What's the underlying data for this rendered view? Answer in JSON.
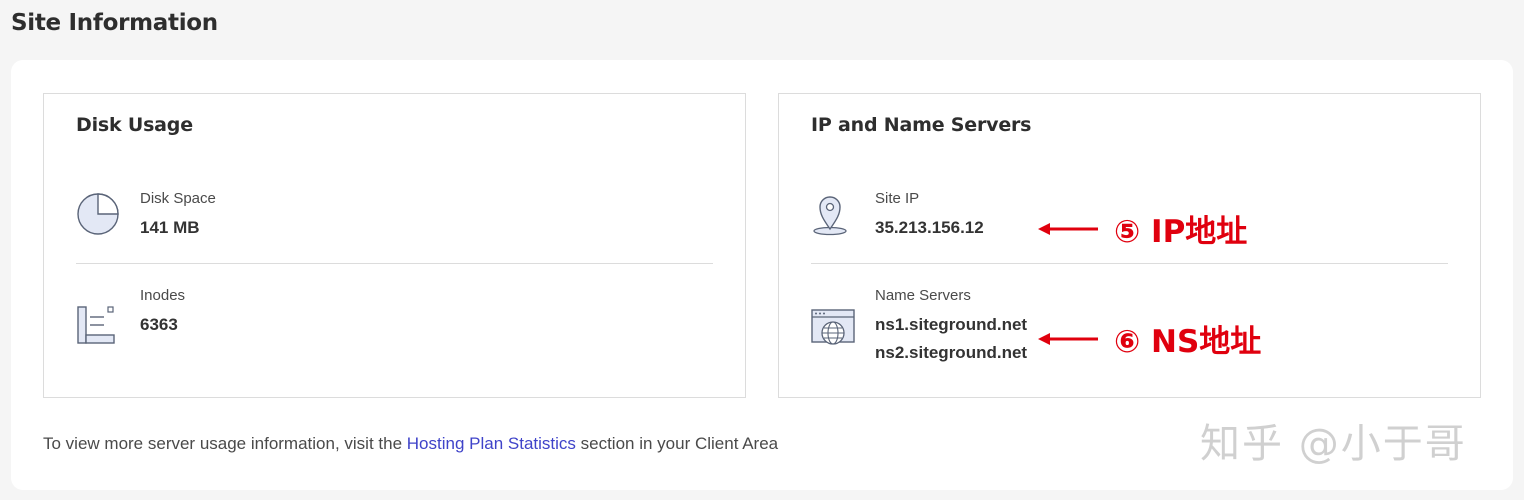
{
  "page": {
    "title": "Site Information"
  },
  "disk_usage": {
    "title": "Disk Usage",
    "disk_space": {
      "label": "Disk Space",
      "value": "141 MB",
      "icon": "pie-chart-icon"
    },
    "inodes": {
      "label": "Inodes",
      "value": "6363",
      "icon": "inodes-icon"
    }
  },
  "ip_servers": {
    "title": "IP and Name Servers",
    "site_ip": {
      "label": "Site IP",
      "value": "35.213.156.12",
      "icon": "location-pin-icon"
    },
    "name_servers": {
      "label": "Name Servers",
      "values": [
        "ns1.siteground.net",
        "ns2.siteground.net"
      ],
      "icon": "globe-browser-icon"
    }
  },
  "footer": {
    "text_before": "To view more server usage information, visit the ",
    "link": "Hosting Plan Statistics",
    "text_after": " section in your Client Area"
  },
  "annotations": {
    "ip": "⑤ IP地址",
    "ns": "⑥ NS地址",
    "color": "#e0000e"
  },
  "watermark": "知乎 @小于哥",
  "colors": {
    "link": "#3f43c9",
    "icon_fill": "#e3e8f5",
    "icon_stroke": "#5a6478"
  }
}
